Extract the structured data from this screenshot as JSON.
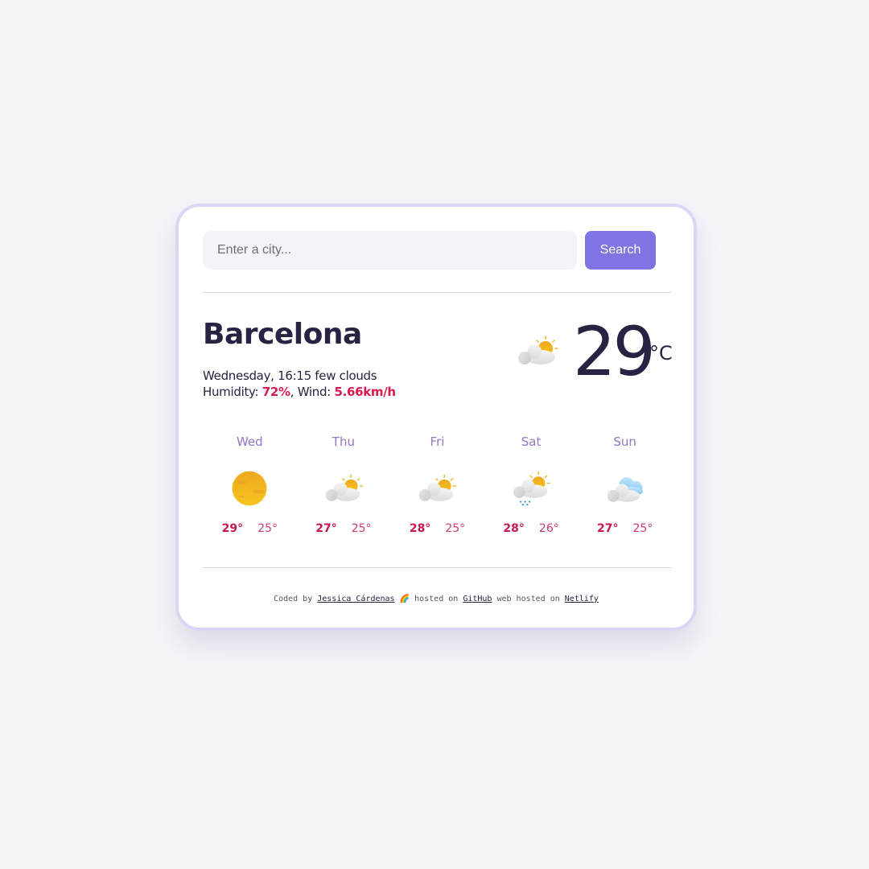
{
  "search": {
    "placeholder": "Enter a city...",
    "value": "",
    "button_label": "Search"
  },
  "current": {
    "city": "Barcelona",
    "day_time": "Wednesday, 16:15",
    "description": "few clouds",
    "humidity_label": "Humidity:",
    "humidity": "72%",
    "wind_label": "Wind:",
    "wind": "5.66km/h",
    "icon": "few-clouds-icon",
    "temperature": "29",
    "unit": "°C"
  },
  "forecast": [
    {
      "day": "Wed",
      "icon": "clear-sky-icon",
      "max": "29°",
      "min": "25°"
    },
    {
      "day": "Thu",
      "icon": "few-clouds-icon",
      "max": "27°",
      "min": "25°"
    },
    {
      "day": "Fri",
      "icon": "few-clouds-icon",
      "max": "28°",
      "min": "25°"
    },
    {
      "day": "Sat",
      "icon": "light-rain-icon",
      "max": "28°",
      "min": "26°"
    },
    {
      "day": "Sun",
      "icon": "broken-clouds-icon",
      "max": "27°",
      "min": "25°"
    }
  ],
  "footer": {
    "coded_by": "Coded by",
    "author": "Jessica Cárdenas",
    "icon": "🌈",
    "hosted_on": "hosted on",
    "github": "GitHub",
    "web_hosted_on": "web hosted on",
    "netlify": "Netlify"
  },
  "colors": {
    "accent": "#7f74e2",
    "highlight": "#d81b4f",
    "day_label": "#9475c7",
    "text": "#272343",
    "card_border": "#ddd5f4"
  }
}
